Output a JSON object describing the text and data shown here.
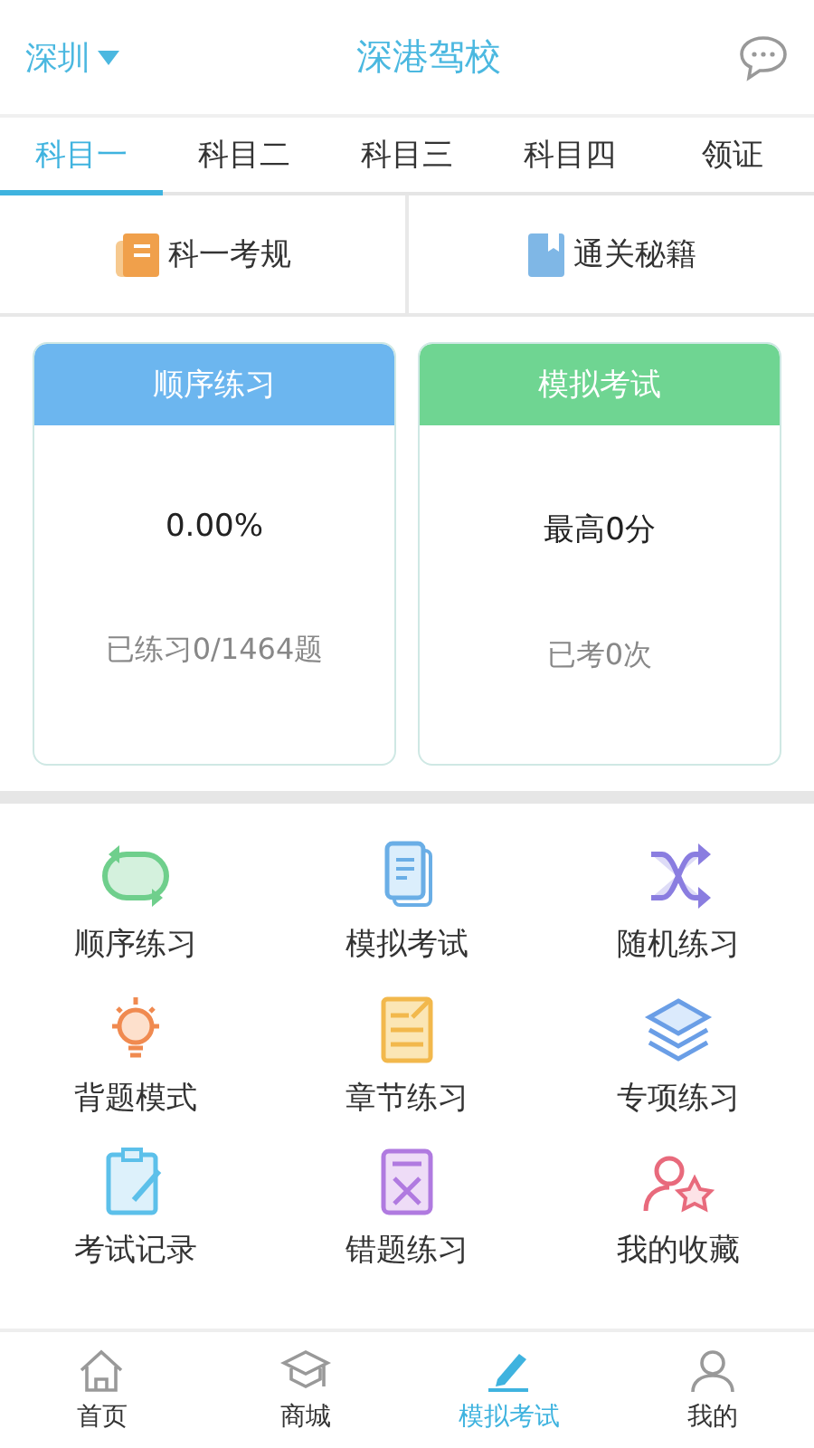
{
  "header": {
    "city": "深圳",
    "title": "深港驾校"
  },
  "subject_tabs": [
    {
      "label": "科目一",
      "selected": true
    },
    {
      "label": "科目二",
      "selected": false
    },
    {
      "label": "科目三",
      "selected": false
    },
    {
      "label": "科目四",
      "selected": false
    },
    {
      "label": "领证",
      "selected": false
    }
  ],
  "quick_links": [
    {
      "kind": "rules",
      "label": "科一考规"
    },
    {
      "kind": "secrets",
      "label": "通关秘籍"
    }
  ],
  "cards": [
    {
      "title": "顺序练习",
      "value": "0.00%",
      "note": "已练习0/1464题",
      "color": "#6cb6ef"
    },
    {
      "title": "模拟考试",
      "value": "最高0分",
      "note": "已考0次",
      "color": "#6fd592"
    }
  ],
  "features": [
    {
      "kind": "loop",
      "label": "顺序练习"
    },
    {
      "kind": "doc",
      "label": "模拟考试"
    },
    {
      "kind": "shuffle",
      "label": "随机练习"
    },
    {
      "kind": "bulb",
      "label": "背题模式"
    },
    {
      "kind": "note",
      "label": "章节练习"
    },
    {
      "kind": "layers",
      "label": "专项练习"
    },
    {
      "kind": "clipboard",
      "label": "考试记录"
    },
    {
      "kind": "wrong",
      "label": "错题练习"
    },
    {
      "kind": "favorite",
      "label": "我的收藏"
    }
  ],
  "bottom_nav": [
    {
      "kind": "home",
      "label": "首页",
      "selected": false
    },
    {
      "kind": "shop",
      "label": "商城",
      "selected": false
    },
    {
      "kind": "exam",
      "label": "模拟考试",
      "selected": true
    },
    {
      "kind": "me",
      "label": "我的",
      "selected": false
    }
  ]
}
